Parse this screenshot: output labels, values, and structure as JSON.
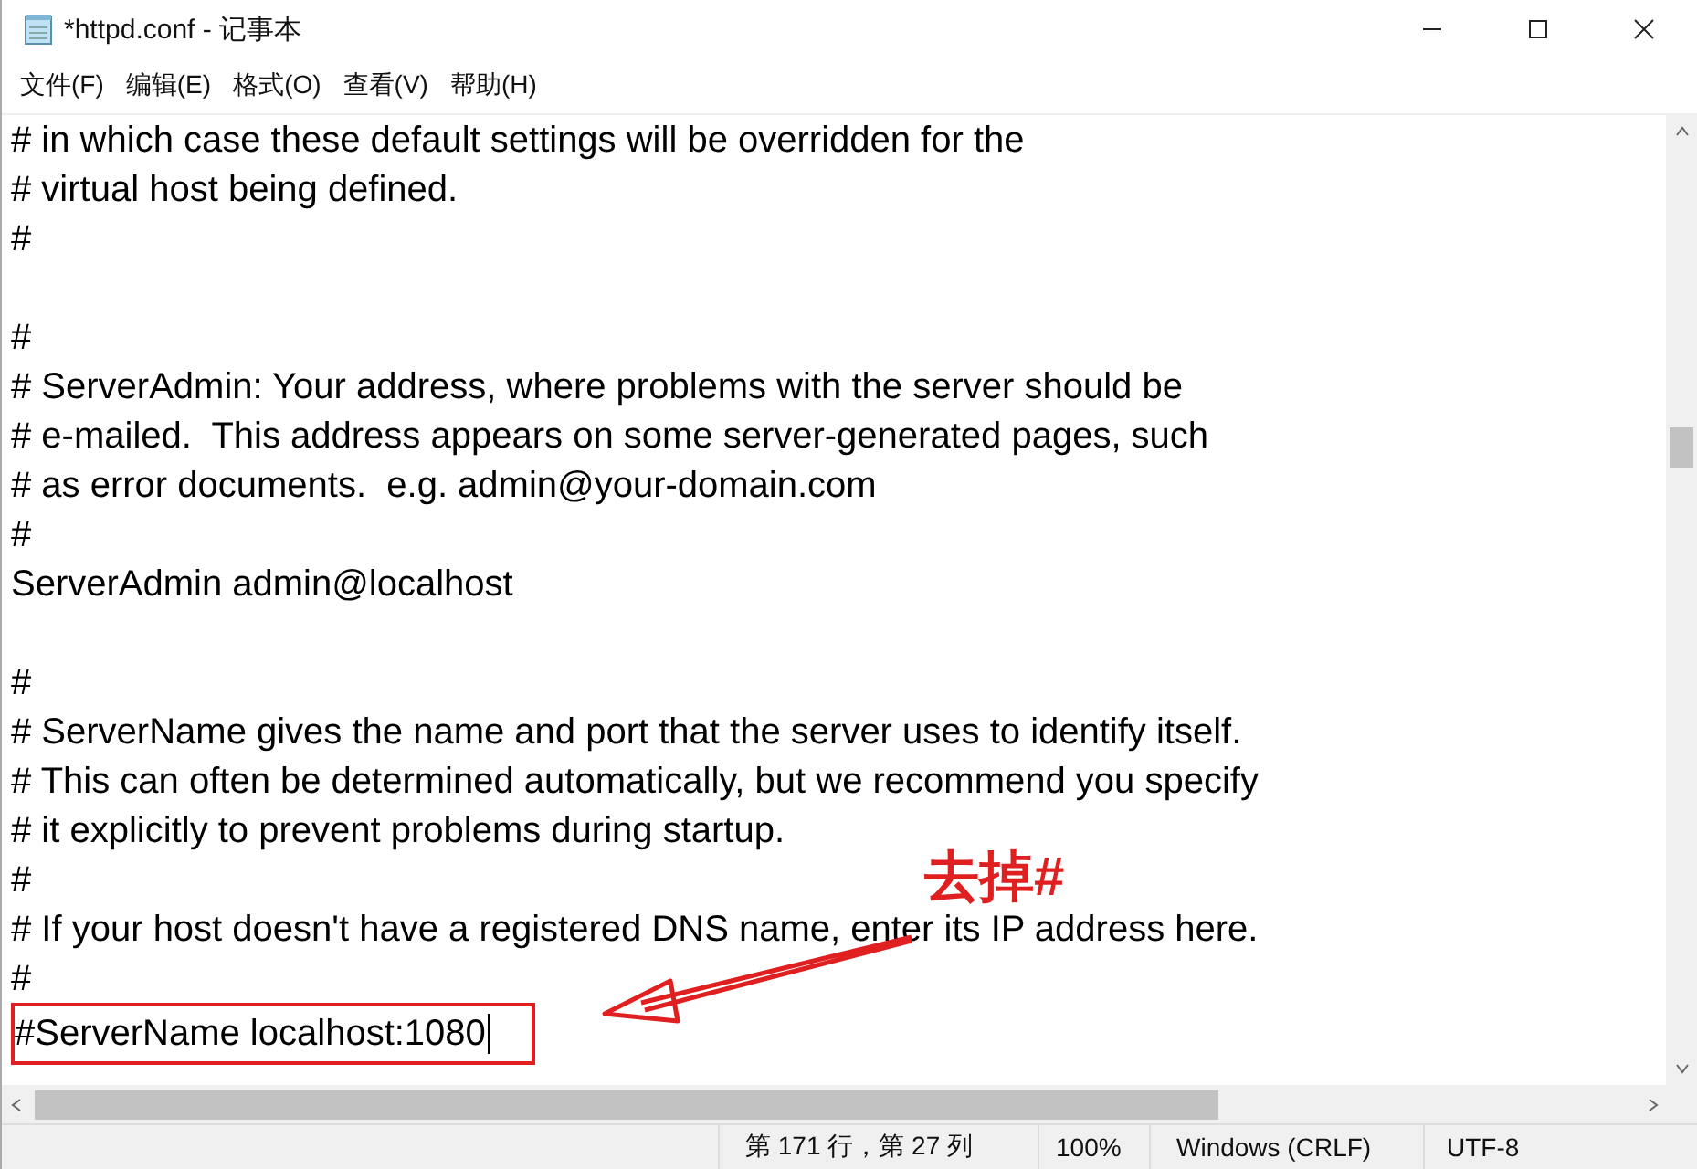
{
  "window": {
    "title": "*httpd.conf - 记事本"
  },
  "menu": [
    "文件(F)",
    "编辑(E)",
    "格式(O)",
    "查看(V)",
    "帮助(H)"
  ],
  "lines": [
    {
      "kind": "text",
      "text": "# in which case these default settings will be overridden for the"
    },
    {
      "kind": "text",
      "text": "# virtual host being defined."
    },
    {
      "kind": "text",
      "text": "#"
    },
    {
      "kind": "blank"
    },
    {
      "kind": "text",
      "text": "#"
    },
    {
      "kind": "text",
      "text": "# ServerAdmin: Your address, where problems with the server should be"
    },
    {
      "kind": "text",
      "text": "# e-mailed.  This address appears on some server-generated pages, such"
    },
    {
      "kind": "text",
      "text": "# as error documents.  e.g. admin@your-domain.com"
    },
    {
      "kind": "text",
      "text": "#"
    },
    {
      "kind": "text",
      "text": "ServerAdmin admin@localhost"
    },
    {
      "kind": "blank"
    },
    {
      "kind": "text",
      "text": "#"
    },
    {
      "kind": "text",
      "text": "# ServerName gives the name and port that the server uses to identify itself."
    },
    {
      "kind": "text",
      "text": "# This can often be determined automatically, but we recommend you specify"
    },
    {
      "kind": "text",
      "text": "# it explicitly to prevent problems during startup."
    },
    {
      "kind": "text",
      "text": "#"
    },
    {
      "kind": "text",
      "text": "# If your host doesn't have a registered DNS name, enter its IP address here."
    },
    {
      "kind": "text",
      "text": "#"
    },
    {
      "kind": "boxed",
      "text": "#ServerName localhost:1080"
    }
  ],
  "annotation": {
    "label": "去掉#"
  },
  "status_bar": [
    "第 171 行，第 27 列",
    "100%",
    "Windows (CRLF)",
    "UTF-8"
  ]
}
